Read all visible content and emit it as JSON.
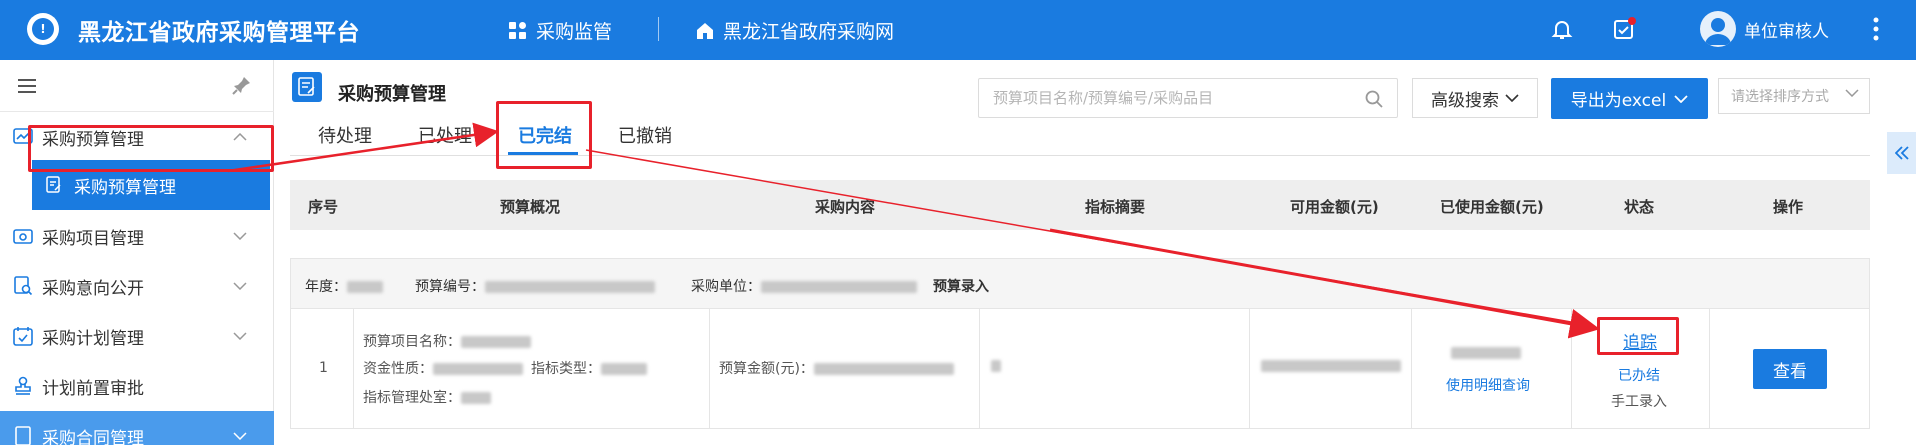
{
  "header": {
    "app_title": "黑龙江省政府采购管理平台",
    "nav_supervision": "采购监管",
    "nav_website": "黑龙江省政府采购网",
    "user_name": "单位审核人"
  },
  "sidebar": {
    "items": [
      {
        "label": "采购预算管理",
        "icon": "chart-line-icon",
        "expanded": true
      },
      {
        "label": "采购项目管理",
        "icon": "camera-folder-icon"
      },
      {
        "label": "采购意向公开",
        "icon": "document-search-icon"
      },
      {
        "label": "采购计划管理",
        "icon": "calendar-check-icon"
      },
      {
        "label": "计划前置审批",
        "icon": "stamp-icon"
      },
      {
        "label": "采购合同管理",
        "icon": "contract-icon"
      }
    ],
    "active_sub_item": "采购预算管理"
  },
  "page": {
    "title": "采购预算管理",
    "tabs": [
      "待处理",
      "已处理",
      "已完结",
      "已撤销"
    ],
    "active_tab": "已完结",
    "search_placeholder": "预算项目名称/预算编号/采购品目",
    "advanced_search": "高级搜索",
    "export_label": "导出为excel",
    "sort_placeholder": "请选择排序方式"
  },
  "table": {
    "columns": [
      "序号",
      "预算概况",
      "采购内容",
      "指标摘要",
      "可用金额(元)",
      "已使用金额(元)",
      "状态",
      "操作"
    ],
    "group": {
      "year_label": "年度：",
      "budget_no_label": "预算编号：",
      "unit_label": "采购单位：",
      "entry_type": "预算录入"
    },
    "rows": [
      {
        "index": "1",
        "project_name_label": "预算项目名称：",
        "fund_nature_label": "资金性质：",
        "indicator_type_label": "指标类型：",
        "dept_label": "指标管理处室：",
        "budget_amount_label": "预算金额(元)：",
        "usage_link": "使用明细查询",
        "track_link": "追踪",
        "status": "已办结",
        "entry_mode": "手工录入",
        "view_button": "查看"
      }
    ]
  },
  "colors": {
    "primary": "#1a7be0",
    "annotation": "#e8212b"
  }
}
